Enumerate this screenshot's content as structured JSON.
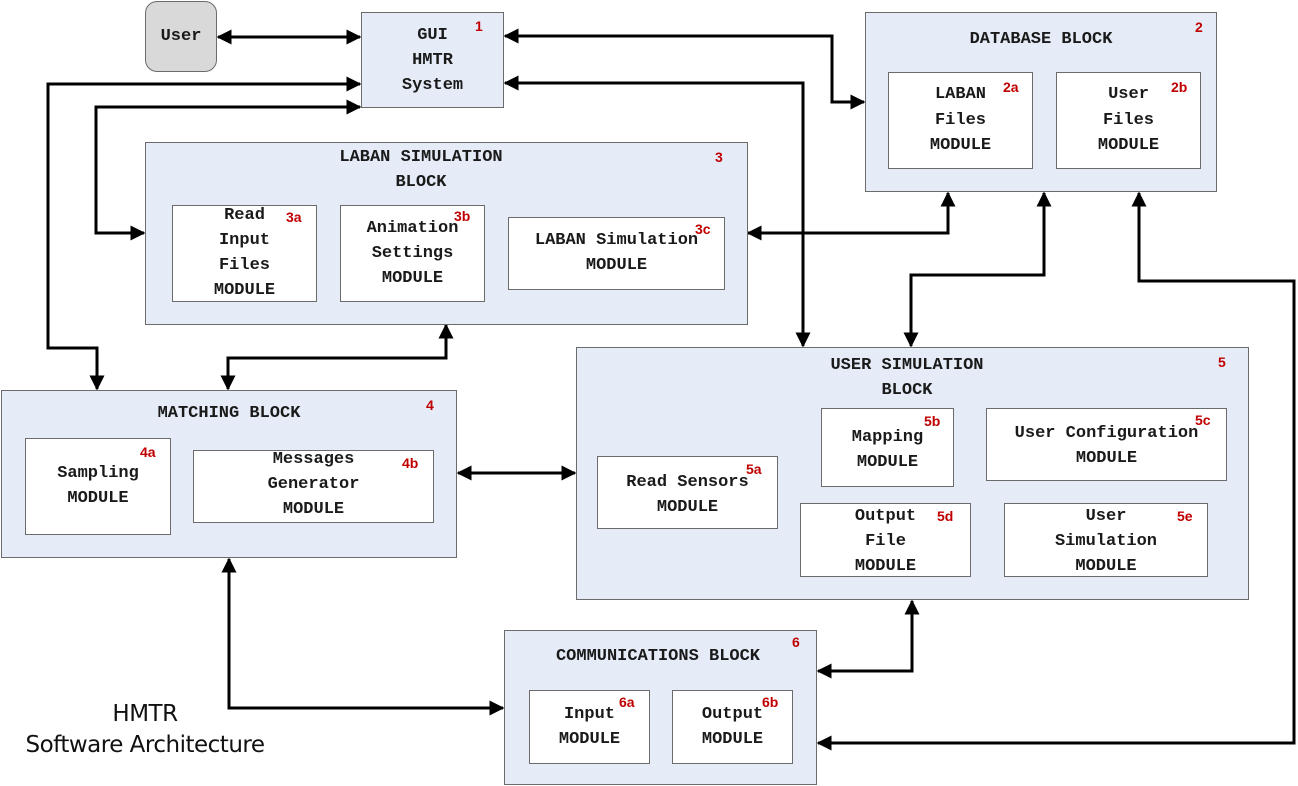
{
  "diagram": {
    "caption": {
      "line1": "HMTR",
      "line2": "Software Architecture"
    },
    "colors": {
      "block_fill": "#e5ecf7",
      "module_fill": "#ffffff",
      "user_fill": "#d9d9d9",
      "tag_red": "#c00000",
      "wire": "#000000"
    },
    "user": {
      "label": "User"
    },
    "gui": {
      "tag": "1",
      "lines": [
        "GUI",
        "HMTR",
        "System"
      ]
    },
    "database": {
      "tag": "2",
      "title": "DATABASE BLOCK",
      "modules": [
        {
          "tag": "2a",
          "lines": [
            "LABAN",
            "Files",
            "MODULE"
          ]
        },
        {
          "tag": "2b",
          "lines": [
            "User",
            "Files",
            "MODULE"
          ]
        }
      ]
    },
    "laban": {
      "tag": "3",
      "title_lines": [
        "LABAN SIMULATION",
        "BLOCK"
      ],
      "modules": [
        {
          "tag": "3a",
          "lines": [
            "Read",
            "Input",
            "Files",
            "MODULE"
          ]
        },
        {
          "tag": "3b",
          "lines": [
            "Animation",
            "Settings",
            "MODULE"
          ]
        },
        {
          "tag": "3c",
          "lines": [
            "LABAN Simulation",
            "MODULE"
          ]
        }
      ]
    },
    "matching": {
      "tag": "4",
      "title": "MATCHING BLOCK",
      "modules": [
        {
          "tag": "4a",
          "lines": [
            "Sampling",
            "MODULE"
          ]
        },
        {
          "tag": "4b",
          "lines": [
            "Messages",
            "Generator",
            "MODULE"
          ]
        }
      ]
    },
    "usersim": {
      "tag": "5",
      "title_lines": [
        "USER SIMULATION",
        "BLOCK"
      ],
      "modules": [
        {
          "tag": "5a",
          "lines": [
            "Read Sensors",
            "MODULE"
          ]
        },
        {
          "tag": "5b",
          "lines": [
            "Mapping",
            "MODULE"
          ]
        },
        {
          "tag": "5c",
          "lines": [
            "User Configuration",
            "MODULE"
          ]
        },
        {
          "tag": "5d",
          "lines": [
            "Output",
            "File",
            "MODULE"
          ]
        },
        {
          "tag": "5e",
          "lines": [
            "User",
            "Simulation",
            "MODULE"
          ]
        }
      ]
    },
    "comms": {
      "tag": "6",
      "title": "COMMUNICATIONS BLOCK",
      "modules": [
        {
          "tag": "6a",
          "lines": [
            "Input",
            "MODULE"
          ]
        },
        {
          "tag": "6b",
          "lines": [
            "Output",
            "MODULE"
          ]
        }
      ]
    },
    "connections": [
      {
        "from": "User",
        "to": "GUI HMTR System",
        "direction": "bidirectional"
      },
      {
        "from": "GUI HMTR System",
        "to": "DATABASE BLOCK",
        "direction": "bidirectional"
      },
      {
        "from": "GUI HMTR System",
        "to": "USER SIMULATION BLOCK",
        "direction": "bidirectional"
      },
      {
        "from": "GUI HMTR System",
        "to": "MATCHING BLOCK",
        "direction": "bidirectional"
      },
      {
        "from": "GUI HMTR System",
        "to": "LABAN SIMULATION BLOCK",
        "direction": "bidirectional"
      },
      {
        "from": "LABAN SIMULATION BLOCK",
        "to": "MATCHING BLOCK",
        "direction": "bidirectional"
      },
      {
        "from": "LABAN SIMULATION BLOCK",
        "to": "DATABASE BLOCK",
        "direction": "bidirectional"
      },
      {
        "from": "USER SIMULATION BLOCK",
        "to": "DATABASE BLOCK",
        "direction": "bidirectional"
      },
      {
        "from": "MATCHING BLOCK",
        "to": "USER SIMULATION BLOCK",
        "direction": "bidirectional"
      },
      {
        "from": "MATCHING BLOCK",
        "to": "COMMUNICATIONS BLOCK",
        "direction": "bidirectional"
      },
      {
        "from": "USER SIMULATION BLOCK",
        "to": "COMMUNICATIONS BLOCK",
        "direction": "bidirectional"
      },
      {
        "from": "DATABASE BLOCK",
        "to": "COMMUNICATIONS BLOCK",
        "direction": "bidirectional"
      }
    ]
  }
}
